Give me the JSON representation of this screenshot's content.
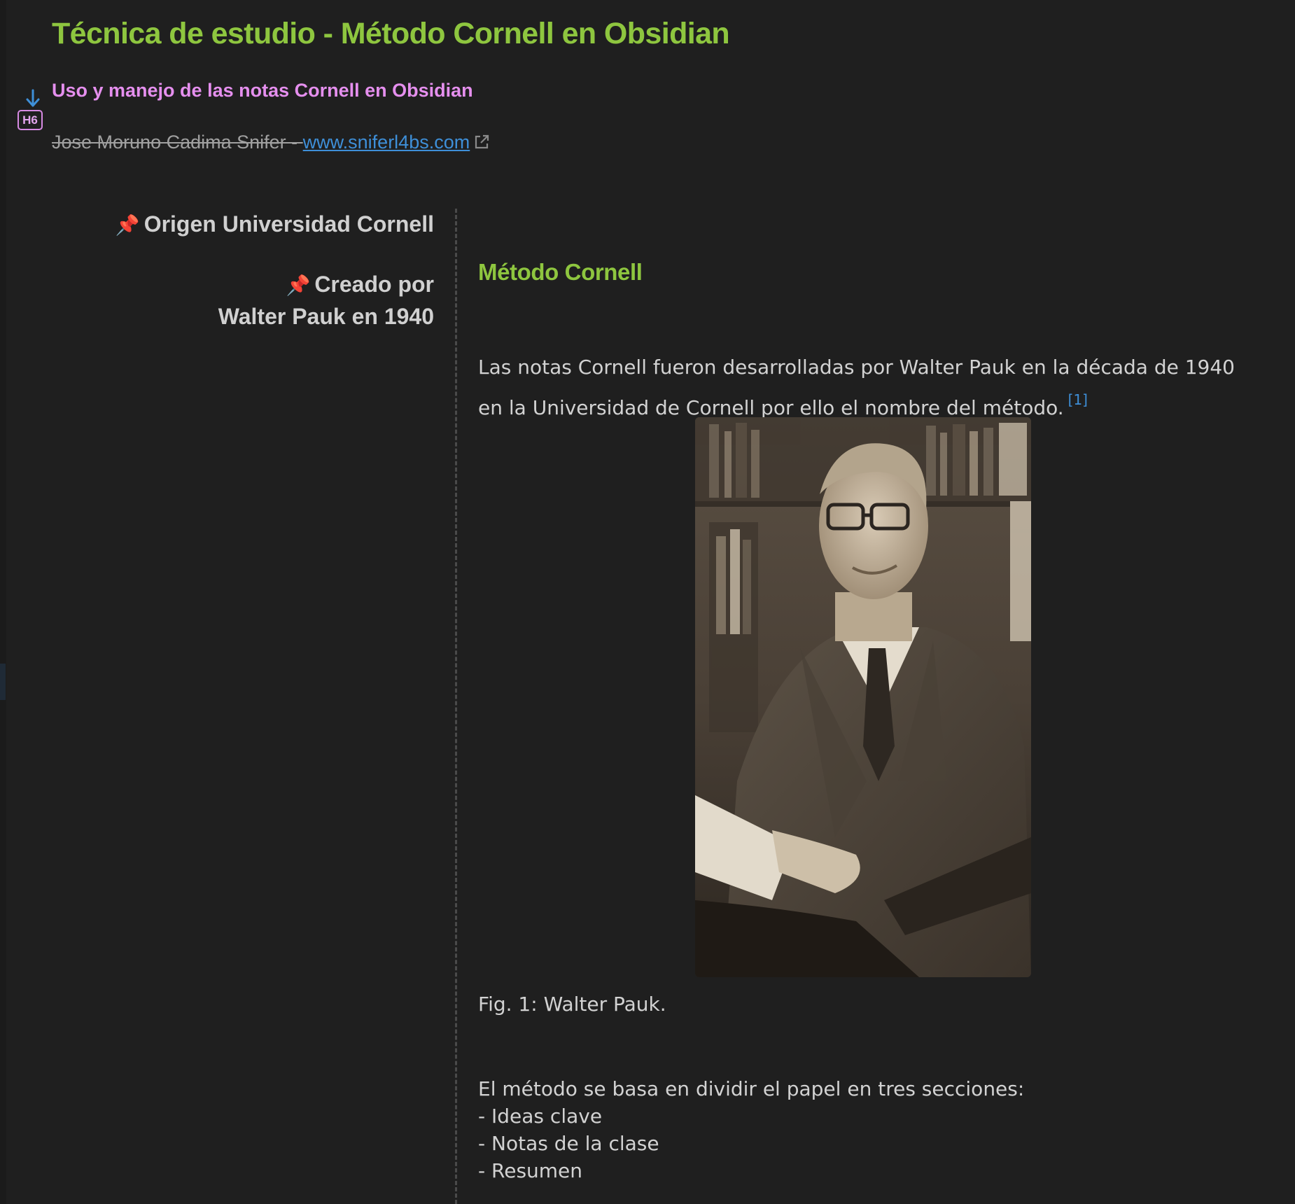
{
  "document": {
    "title": "Técnica de estudio - Método Cornell en Obsidian",
    "subtitle": "Uso y manejo de las notas Cornell en Obsidian",
    "heading_badge": "H6",
    "author": "Jose Moruno Cadima Snifer - ",
    "author_link": "www.sniferl4bs.com"
  },
  "cues": [
    {
      "icon": "pushpin-icon",
      "text": "Origen Universidad Cornell"
    },
    {
      "icon": "pushpin-icon",
      "line1": "Creado por",
      "line2": "Walter Pauk en 1940"
    }
  ],
  "notes": {
    "heading": "Método Cornell",
    "paragraph": "Las notas Cornell fueron desarrolladas por Walter Pauk en la década de 1940 en la Universidad de Cornell por ello el nombre del método.",
    "footnote_ref": "[1]",
    "figure_caption": "Fig. 1: Walter Pauk.",
    "sections_intro": "El método se basa en dividir el papel en tres secciones:",
    "sections": [
      "Ideas clave",
      "Notas de la clase",
      "Resumen"
    ]
  },
  "colors": {
    "background": "#1f1f1f",
    "title_green": "#8ec63f",
    "subtitle_pink": "#e58fee",
    "link_blue": "#3e8fd8",
    "body_text": "#d2d2d2"
  }
}
